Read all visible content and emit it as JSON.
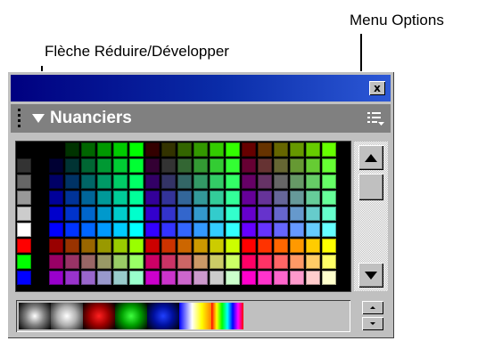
{
  "callouts": {
    "collapse_expand": "Flèche Réduire/Développer",
    "menu_options": "Menu Options"
  },
  "panel": {
    "title": "Nuanciers",
    "close_glyph": "x",
    "icons": {
      "close": "close-icon",
      "collapse": "collapse-arrow-icon",
      "menu": "panel-menu-icon",
      "scroll_up": "scroll-up-arrow-icon",
      "scroll_down": "scroll-down-arrow-icon"
    },
    "colors": {
      "title_gradient": [
        "#000080",
        "#2c58d6"
      ],
      "header_bg": "#808080",
      "chrome": "#c0c0c0"
    }
  },
  "swatches": {
    "left_column": [
      "#000000",
      "#333333",
      "#666666",
      "#999999",
      "#cccccc",
      "#ffffff",
      "#ff0000",
      "#00ff00",
      "#0000ff"
    ],
    "cube_levels": [
      "00",
      "33",
      "66",
      "99",
      "cc",
      "ff"
    ]
  },
  "gradient_swatches": [
    {
      "name": "gray-radial-gradient",
      "css": "radial-gradient(circle at 50% 50%, #ffffff 0%, #808080 45%, #000000 100%)"
    },
    {
      "name": "white-radial-gradient",
      "css": "radial-gradient(circle at 50% 50%, #ffffff 0%, #b0b0b0 45%, #202020 100%)"
    },
    {
      "name": "red-radial-gradient",
      "css": "radial-gradient(circle at 50% 50%, #ff2020 0%, #a00000 45%, #000000 100%)"
    },
    {
      "name": "green-radial-gradient",
      "css": "radial-gradient(circle at 50% 50%, #40ff40 0%, #00a000 45%, #000000 100%)"
    },
    {
      "name": "blue-radial-gradient",
      "css": "radial-gradient(circle at 50% 50%, #2040ff 0%, #0010a0 45%, #000000 100%)"
    },
    {
      "name": "yellow-linear-gradient",
      "css": "linear-gradient(90deg, #0000ff 0%, #ffffff 40%, #ffff00 70%, #ff8000 100%)"
    },
    {
      "name": "rainbow-gradient",
      "css": "linear-gradient(90deg, #ff0000, #ffff00, #00ff00, #00ffff, #0000ff, #ff00ff, #ff0000)"
    }
  ]
}
